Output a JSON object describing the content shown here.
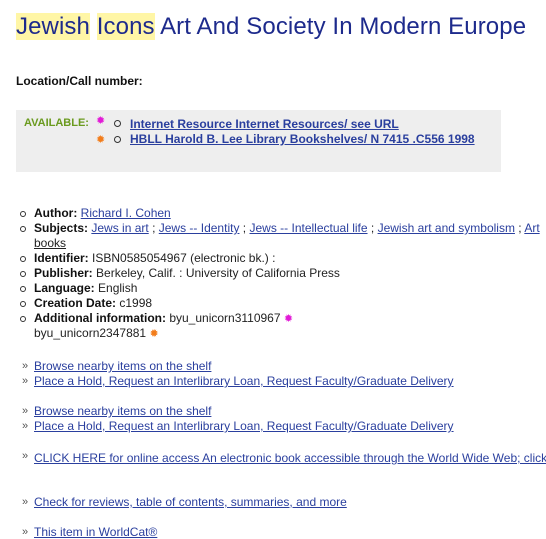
{
  "title": {
    "word1": "Jewish",
    "word2": "Icons",
    "rest": "Art And Society In Modern Europe"
  },
  "location_label": "Location/Call number:",
  "availability": {
    "label": "AVAILABLE:",
    "links": [
      "Internet Resource Internet Resources/ see URL",
      "HBLL Harold B. Lee Library Bookshelves/ N 7415 .C556 1998"
    ]
  },
  "details": {
    "author_label": "Author:",
    "author": "Richard I. Cohen",
    "subjects_label": "Subjects:",
    "subjects": [
      "Jews in art",
      "Jews -- Identity",
      "Jews -- Intellectual life",
      "Jewish art and symbolism",
      "Art",
      "books"
    ],
    "subject_sep": ";",
    "identifier_label": "Identifier:",
    "identifier": "ISBN0585054967 (electronic bk.) :",
    "publisher_label": "Publisher:",
    "publisher": "Berkeley, Calif. : University of California Press",
    "language_label": "Language:",
    "language": "English",
    "creation_label": "Creation Date:",
    "creation": "c1998",
    "additional_label": "Additional information:",
    "additional1": "byu_unicorn3110967",
    "additional2": "byu_unicorn2347881"
  },
  "actions": {
    "browse1": "Browse nearby items on the shelf",
    "hold1": "Place a Hold, Request an Interlibrary Loan, Request Faculty/Graduate Delivery",
    "browse2": "Browse nearby items on the shelf",
    "hold2": "Place a Hold, Request an Interlibrary Loan, Request Faculty/Graduate Delivery",
    "online": "CLICK HERE for online access An electronic book accessible through the World Wide Web; click",
    "reviews": "Check for reviews, table of contents, summaries, and more",
    "worldcat": "This item in WorldCat®"
  },
  "icons": {
    "marker_pink": "pink-star-icon",
    "marker_orange": "orange-star-icon",
    "bullet": "circle-bullet-icon",
    "arrow": "double-chevron-icon"
  },
  "colors": {
    "title": "#1d2a8c",
    "highlight": "#fff6a6",
    "available": "#6a9a1e",
    "link": "#2a3f9e",
    "marker_pink": "#e21ad6",
    "marker_orange": "#f27c1a"
  }
}
